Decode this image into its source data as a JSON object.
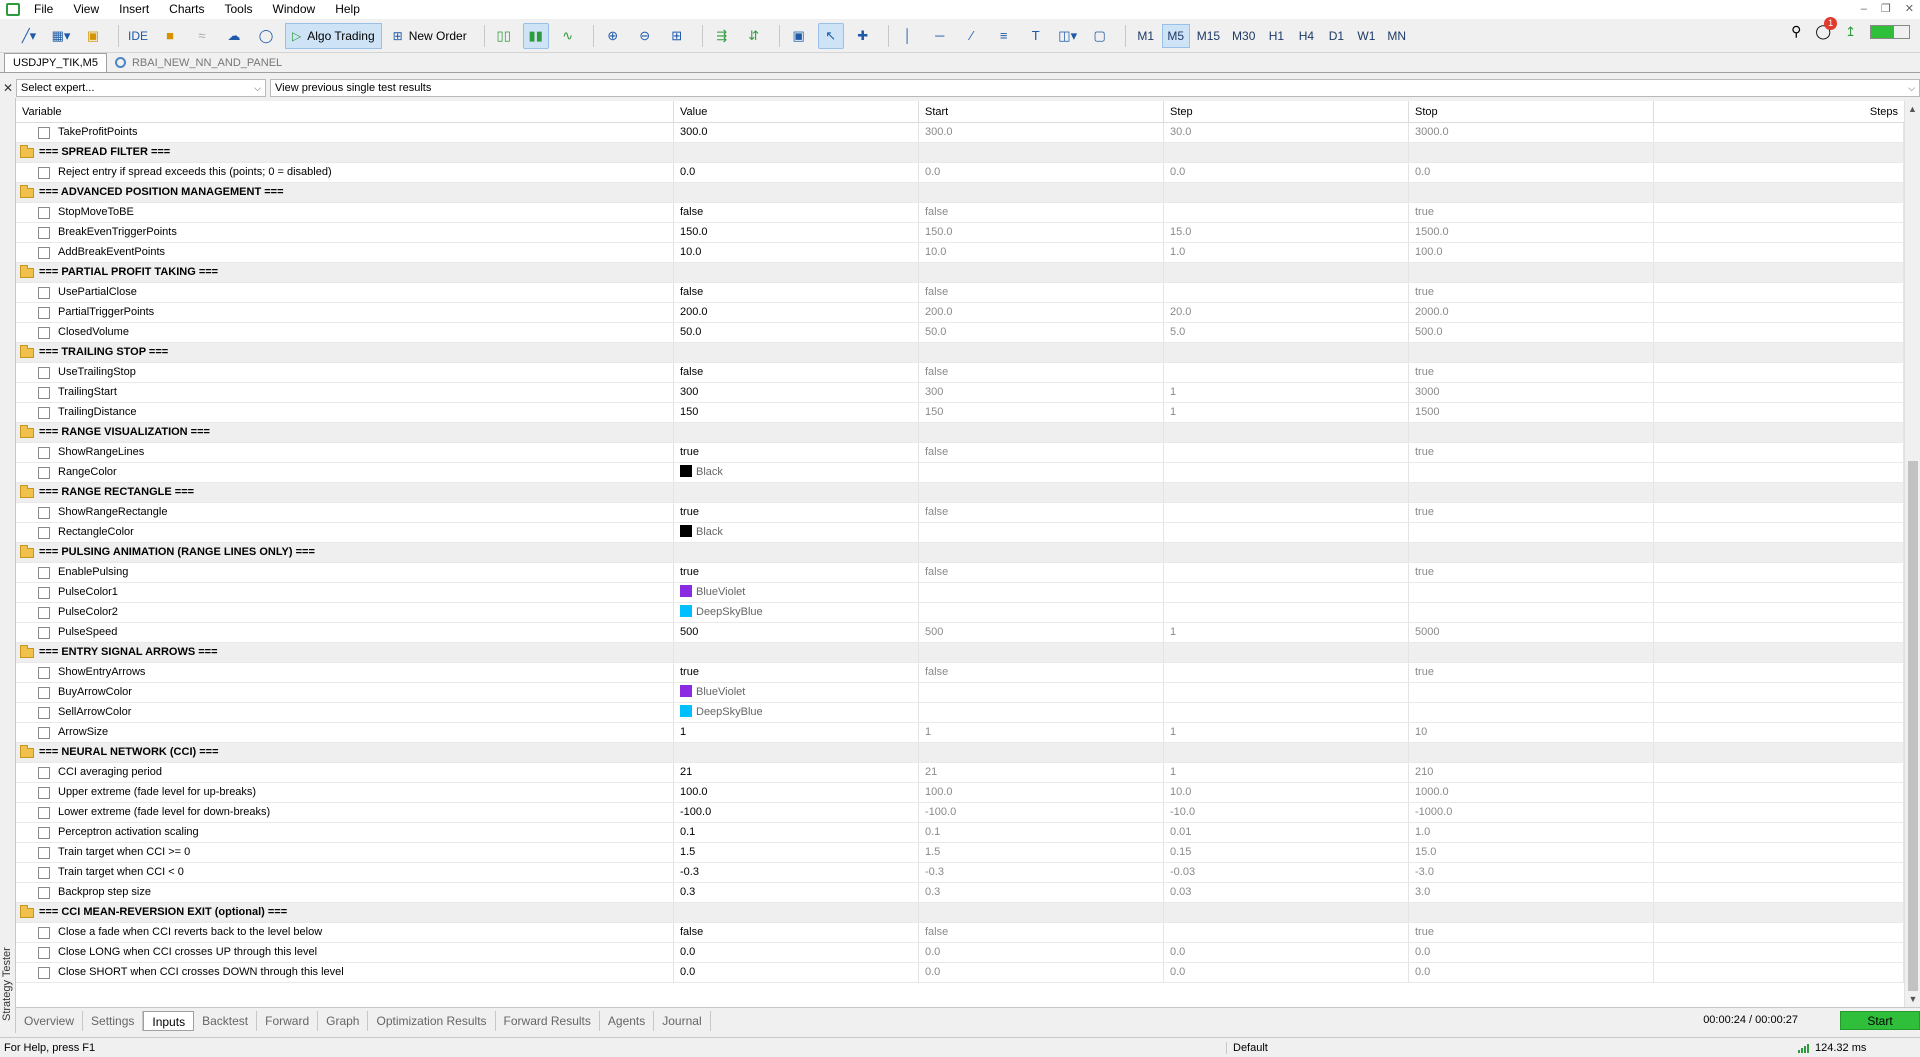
{
  "menu": [
    "File",
    "View",
    "Insert",
    "Charts",
    "Tools",
    "Window",
    "Help"
  ],
  "toolbar": {
    "algo_trading": "Algo Trading",
    "new_order": "New Order",
    "ide": "IDE",
    "timeframes": [
      "M1",
      "M5",
      "M15",
      "M30",
      "H1",
      "H4",
      "D1",
      "W1",
      "MN"
    ],
    "active_timeframe": "M5",
    "notifications": "1"
  },
  "chart_tabs": {
    "active": "USDJPY_TIK,M5",
    "other": "RBAI_NEW_NN_AND_PANEL"
  },
  "expert_bar": {
    "expert_select": "Select expert...",
    "results_select": "View previous single test results"
  },
  "side_label": "Strategy Tester",
  "columns": {
    "variable": "Variable",
    "value": "Value",
    "start": "Start",
    "step": "Step",
    "stop": "Stop",
    "steps": "Steps"
  },
  "rows": [
    {
      "type": "param",
      "name": "TakeProfitPoints",
      "value": "300.0",
      "start": "300.0",
      "step": "30.0",
      "stop": "3000.0"
    },
    {
      "type": "group",
      "name": "=== SPREAD FILTER ==="
    },
    {
      "type": "param",
      "name": "Reject entry if spread exceeds this (points; 0 = disabled)",
      "value": "0.0",
      "start": "0.0",
      "step": "0.0",
      "stop": "0.0"
    },
    {
      "type": "group",
      "name": "=== ADVANCED POSITION MANAGEMENT ==="
    },
    {
      "type": "param",
      "name": "StopMoveToBE",
      "value": "false",
      "start": "false",
      "step": "",
      "stop": "true"
    },
    {
      "type": "param",
      "name": "BreakEvenTriggerPoints",
      "value": "150.0",
      "start": "150.0",
      "step": "15.0",
      "stop": "1500.0"
    },
    {
      "type": "param",
      "name": "AddBreakEventPoints",
      "value": "10.0",
      "start": "10.0",
      "step": "1.0",
      "stop": "100.0"
    },
    {
      "type": "group",
      "name": "=== PARTIAL PROFIT TAKING ==="
    },
    {
      "type": "param",
      "name": "UsePartialClose",
      "value": "false",
      "start": "false",
      "step": "",
      "stop": "true"
    },
    {
      "type": "param",
      "name": "PartialTriggerPoints",
      "value": "200.0",
      "start": "200.0",
      "step": "20.0",
      "stop": "2000.0"
    },
    {
      "type": "param",
      "name": "ClosedVolume",
      "value": "50.0",
      "start": "50.0",
      "step": "5.0",
      "stop": "500.0"
    },
    {
      "type": "group",
      "name": "=== TRAILING STOP ==="
    },
    {
      "type": "param",
      "name": "UseTrailingStop",
      "value": "false",
      "start": "false",
      "step": "",
      "stop": "true"
    },
    {
      "type": "param",
      "name": "TrailingStart",
      "value": "300",
      "start": "300",
      "step": "1",
      "stop": "3000"
    },
    {
      "type": "param",
      "name": "TrailingDistance",
      "value": "150",
      "start": "150",
      "step": "1",
      "stop": "1500"
    },
    {
      "type": "group",
      "name": "=== RANGE VISUALIZATION ==="
    },
    {
      "type": "param",
      "name": "ShowRangeLines",
      "value": "true",
      "start": "false",
      "step": "",
      "stop": "true"
    },
    {
      "type": "param",
      "name": "RangeColor",
      "value": "Black",
      "color": "#000000",
      "start": "",
      "step": "",
      "stop": ""
    },
    {
      "type": "group",
      "name": "=== RANGE RECTANGLE ==="
    },
    {
      "type": "param",
      "name": "ShowRangeRectangle",
      "value": "true",
      "start": "false",
      "step": "",
      "stop": "true"
    },
    {
      "type": "param",
      "name": "RectangleColor",
      "value": "Black",
      "color": "#000000",
      "start": "",
      "step": "",
      "stop": ""
    },
    {
      "type": "group",
      "name": "=== PULSING ANIMATION (RANGE LINES ONLY) ==="
    },
    {
      "type": "param",
      "name": "EnablePulsing",
      "value": "true",
      "start": "false",
      "step": "",
      "stop": "true"
    },
    {
      "type": "param",
      "name": "PulseColor1",
      "value": "BlueViolet",
      "color": "#8a2be2",
      "start": "",
      "step": "",
      "stop": ""
    },
    {
      "type": "param",
      "name": "PulseColor2",
      "value": "DeepSkyBlue",
      "color": "#00bfff",
      "start": "",
      "step": "",
      "stop": ""
    },
    {
      "type": "param",
      "name": "PulseSpeed",
      "value": "500",
      "start": "500",
      "step": "1",
      "stop": "5000"
    },
    {
      "type": "group",
      "name": "=== ENTRY SIGNAL ARROWS ==="
    },
    {
      "type": "param",
      "name": "ShowEntryArrows",
      "value": "true",
      "start": "false",
      "step": "",
      "stop": "true"
    },
    {
      "type": "param",
      "name": "BuyArrowColor",
      "value": "BlueViolet",
      "color": "#8a2be2",
      "start": "",
      "step": "",
      "stop": ""
    },
    {
      "type": "param",
      "name": "SellArrowColor",
      "value": "DeepSkyBlue",
      "color": "#00bfff",
      "start": "",
      "step": "",
      "stop": ""
    },
    {
      "type": "param",
      "name": "ArrowSize",
      "value": "1",
      "start": "1",
      "step": "1",
      "stop": "10"
    },
    {
      "type": "group",
      "name": "=== NEURAL NETWORK (CCI) ==="
    },
    {
      "type": "param",
      "name": "CCI averaging period",
      "value": "21",
      "start": "21",
      "step": "1",
      "stop": "210"
    },
    {
      "type": "param",
      "name": "Upper extreme (fade level for up-breaks)",
      "value": "100.0",
      "start": "100.0",
      "step": "10.0",
      "stop": "1000.0"
    },
    {
      "type": "param",
      "name": "Lower extreme (fade level for down-breaks)",
      "value": "-100.0",
      "start": "-100.0",
      "step": "-10.0",
      "stop": "-1000.0"
    },
    {
      "type": "param",
      "name": "Perceptron activation scaling",
      "value": "0.1",
      "start": "0.1",
      "step": "0.01",
      "stop": "1.0"
    },
    {
      "type": "param",
      "name": "Train target when CCI >= 0",
      "value": "1.5",
      "start": "1.5",
      "step": "0.15",
      "stop": "15.0"
    },
    {
      "type": "param",
      "name": "Train target when CCI < 0",
      "value": "-0.3",
      "start": "-0.3",
      "step": "-0.03",
      "stop": "-3.0"
    },
    {
      "type": "param",
      "name": "Backprop step size",
      "value": "0.3",
      "start": "0.3",
      "step": "0.03",
      "stop": "3.0"
    },
    {
      "type": "group",
      "name": "=== CCI MEAN-REVERSION EXIT (optional) ==="
    },
    {
      "type": "param",
      "name": "Close a fade when CCI reverts back to the level below",
      "value": "false",
      "start": "false",
      "step": "",
      "stop": "true"
    },
    {
      "type": "param",
      "name": "Close LONG when CCI crosses UP through this level",
      "value": "0.0",
      "start": "0.0",
      "step": "0.0",
      "stop": "0.0"
    },
    {
      "type": "param",
      "name": "Close SHORT when CCI crosses DOWN through this level",
      "value": "0.0",
      "start": "0.0",
      "step": "0.0",
      "stop": "0.0"
    }
  ],
  "bottom_tabs": [
    "Overview",
    "Settings",
    "Inputs",
    "Backtest",
    "Forward",
    "Graph",
    "Optimization Results",
    "Forward Results",
    "Agents",
    "Journal"
  ],
  "active_bottom_tab": "Inputs",
  "timer": "00:00:24 / 00:00:27",
  "start_button": "Start",
  "status": {
    "help": "For Help, press F1",
    "profile": "Default",
    "ping": "124.32 ms"
  },
  "colors": {
    "accent": "#2fbf3a",
    "selection": "#cfe3f7",
    "folder": "#f0c14b"
  }
}
